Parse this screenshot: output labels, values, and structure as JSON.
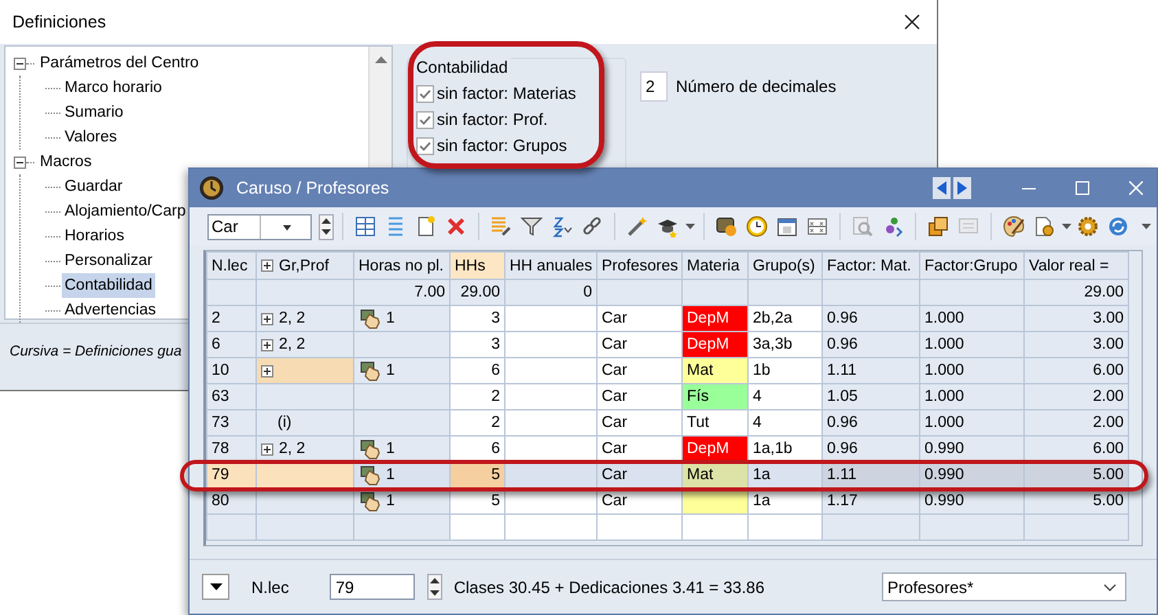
{
  "dialog": {
    "title": "Definiciones",
    "tree": [
      {
        "label": "Parámetros del Centro",
        "expanded": true,
        "selected": false,
        "children": [
          {
            "label": "Marco horario",
            "selected": false
          },
          {
            "label": "Sumario",
            "selected": false
          },
          {
            "label": "Valores",
            "selected": false
          }
        ]
      },
      {
        "label": "Macros",
        "expanded": true,
        "selected": false,
        "children": [
          {
            "label": "Guardar",
            "selected": false
          },
          {
            "label": "Alojamiento/Carp",
            "selected": false
          },
          {
            "label": "Horarios",
            "selected": false
          },
          {
            "label": "Personalizar",
            "selected": false
          },
          {
            "label": "Contabilidad",
            "selected": true
          },
          {
            "label": "Advertencias",
            "selected": false
          }
        ]
      }
    ],
    "group": {
      "title": "Contabilidad",
      "options": [
        {
          "label": "sin factor: Materias",
          "checked": true
        },
        {
          "label": "sin factor: Prof.",
          "checked": true
        },
        {
          "label": "sin factor: Grupos",
          "checked": true
        }
      ]
    },
    "decimals": {
      "value": "2",
      "label": "Número de decimales"
    },
    "footnote": "Cursiva = Definiciones gua"
  },
  "window": {
    "title": "Caruso / Profesores",
    "filter": {
      "value": "Car"
    },
    "table": {
      "columns": [
        {
          "label": "N.lec",
          "expander": false,
          "highlighted": false
        },
        {
          "label": "Gr,Prof",
          "expander": true,
          "highlighted": false
        },
        {
          "label": "Horas no pl.",
          "expander": false,
          "highlighted": false
        },
        {
          "label": "HHs",
          "expander": false,
          "highlighted": true
        },
        {
          "label": "HH anuales",
          "expander": false,
          "highlighted": false
        },
        {
          "label": "Profesores",
          "expander": false,
          "highlighted": false
        },
        {
          "label": "Materia",
          "expander": false,
          "highlighted": false
        },
        {
          "label": "Grupo(s)",
          "expander": false,
          "highlighted": false
        },
        {
          "label": "Factor: Mat.",
          "expander": false,
          "highlighted": false
        },
        {
          "label": "Factor:Grupo",
          "expander": false,
          "highlighted": false
        },
        {
          "label": "Valor real =",
          "expander": false,
          "highlighted": false
        }
      ],
      "totals": {
        "horas_no_pl": "7.00",
        "hhs": "29.00",
        "hh_anuales": "0",
        "valor_real": "29.00"
      },
      "rows": [
        {
          "cells": [
            "2",
            "2, 2",
            "1",
            "3",
            null,
            "Car",
            "DepM",
            "2b,2a",
            "0.96",
            "1.000",
            "3.00"
          ],
          "expand": true,
          "hand": true,
          "marked": false,
          "color": "#ff0000",
          "selected": false
        },
        {
          "cells": [
            "6",
            "2, 2",
            null,
            "3",
            null,
            "Car",
            "DepM",
            "3a,3b",
            "0.96",
            "1.000",
            "3.00"
          ],
          "expand": true,
          "hand": false,
          "marked": false,
          "color": "#ff0000",
          "selected": false
        },
        {
          "cells": [
            "10",
            null,
            "1",
            "6",
            null,
            "Car",
            "Mat",
            "1b",
            "1.11",
            "1.000",
            "6.00"
          ],
          "expand": true,
          "hand": true,
          "marked": true,
          "color": "#ffff99",
          "selected": false
        },
        {
          "cells": [
            "63",
            null,
            null,
            "2",
            null,
            "Car",
            "Fís",
            "4",
            "1.05",
            "1.000",
            "2.00"
          ],
          "expand": false,
          "hand": false,
          "marked": false,
          "color": "#99ff99",
          "selected": false
        },
        {
          "cells": [
            "73",
            "(i)",
            null,
            "2",
            null,
            "Car",
            "Tut",
            "4",
            "0.96",
            "1.000",
            "2.00"
          ],
          "expand": false,
          "hand": false,
          "marked": false,
          "color": "#ffffff",
          "selected": false
        },
        {
          "cells": [
            "78",
            "2, 2",
            "1",
            "6",
            null,
            "Car",
            "DepM",
            "1a,1b",
            "0.96",
            "0.990",
            "6.00"
          ],
          "expand": true,
          "hand": true,
          "marked": false,
          "color": "#ff0000",
          "selected": false
        },
        {
          "cells": [
            "79",
            null,
            "1",
            "5",
            null,
            "Car",
            "Mat",
            "1a",
            "1.11",
            "0.990",
            "5.00"
          ],
          "expand": false,
          "hand": true,
          "marked": false,
          "color": "#dde3a6",
          "selected": true
        },
        {
          "cells": [
            "80",
            null,
            "1",
            "5",
            null,
            "Car",
            null,
            "1a",
            "1.17",
            "0.990",
            "5.00"
          ],
          "expand": false,
          "hand": true,
          "marked": false,
          "color": "#ffff99",
          "selected": false
        }
      ]
    },
    "footer": {
      "field_label": "N.lec",
      "value": "79",
      "summary": "Clases 30.45 + Dedicaciones 3.41 = 33.86",
      "view": "Profesores*"
    }
  }
}
